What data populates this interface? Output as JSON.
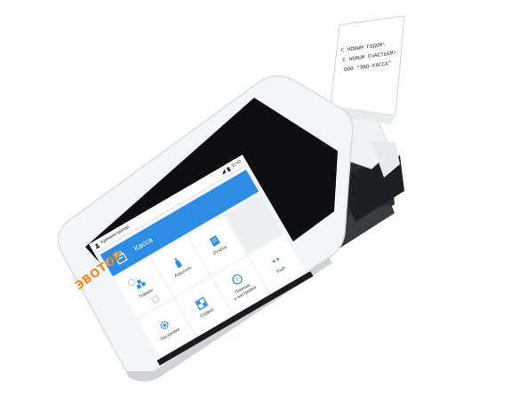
{
  "app": {
    "user_label": "Администратор",
    "time": "11:42",
    "primary_action": "Касса",
    "tiles": [
      {
        "label": "Товары",
        "icon": "goods-icon"
      },
      {
        "label": "Алкоголь",
        "icon": "bottle-icon"
      },
      {
        "label": "Отчёты",
        "icon": "report-icon"
      },
      {
        "label": "Настройки",
        "icon": "gear-icon"
      },
      {
        "label": "Сервис",
        "icon": "grid-icon"
      },
      {
        "label": "Помощь\nи настройка",
        "icon": "help-icon"
      },
      {
        "label": "Ещё",
        "icon": "more-icon"
      }
    ]
  },
  "device": {
    "brand": "ЭВОТОР",
    "receipt_lines": [
      "С НОВЫМ ГОДОМ!",
      "С НОВЫМ СЧАСТЬЕМ!",
      "ООО \"ЭВО-КАССА\""
    ]
  },
  "colors": {
    "accent": "#2d8de4",
    "brand": "#f08a1c",
    "body": "#e8eaed",
    "dark": "#2a2b2d"
  }
}
